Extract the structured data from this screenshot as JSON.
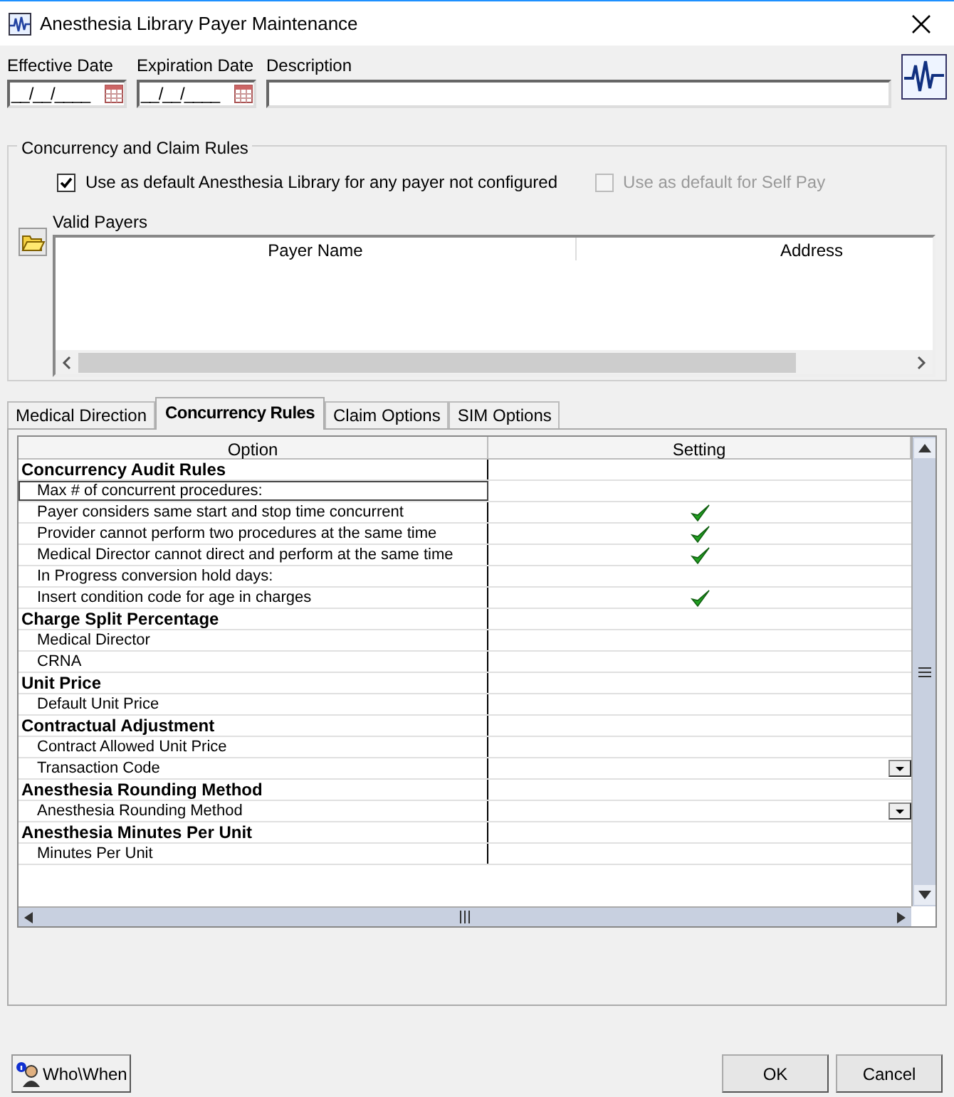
{
  "window": {
    "title": "Anesthesia Library Payer Maintenance"
  },
  "header": {
    "effective_date": {
      "label": "Effective Date",
      "value": "__/__/____"
    },
    "expiration_date": {
      "label": "Expiration Date",
      "value": "__/__/____"
    },
    "description": {
      "label": "Description"
    }
  },
  "rules_group": {
    "title": "Concurrency and Claim Rules",
    "checkboxes": [
      {
        "label": "Use as default Anesthesia Library for any payer not configured",
        "checked": true,
        "disabled": false
      },
      {
        "label": "Use as default for Self Pay",
        "checked": false,
        "disabled": true
      }
    ],
    "valid_payers": {
      "label": "Valid Payers",
      "columns": [
        "Payer Name",
        "Address"
      ]
    }
  },
  "tabs": [
    {
      "label": "Medical Direction",
      "selected": false
    },
    {
      "label": "Concurrency Rules",
      "selected": true
    },
    {
      "label": "Claim Options",
      "selected": false
    },
    {
      "label": "SIM Options",
      "selected": false
    }
  ],
  "grid": {
    "columns": [
      "Option",
      "Setting"
    ],
    "rows": [
      {
        "kind": "group",
        "label": "Concurrency Audit Rules"
      },
      {
        "kind": "item",
        "label": "Max # of concurrent procedures:",
        "checked": false,
        "selected": true
      },
      {
        "kind": "item",
        "label": "Payer considers same start and stop time concurrent",
        "checked": true,
        "selected": false
      },
      {
        "kind": "item",
        "label": "Provider cannot perform two procedures at the same time",
        "checked": true,
        "selected": false
      },
      {
        "kind": "item",
        "label": "Medical Director cannot direct and perform at the same time",
        "checked": true,
        "selected": false
      },
      {
        "kind": "item",
        "label": "In Progress conversion hold days:",
        "checked": false,
        "selected": false
      },
      {
        "kind": "item",
        "label": "Insert condition code for age in charges",
        "checked": true,
        "selected": false
      },
      {
        "kind": "group",
        "label": "Charge Split Percentage"
      },
      {
        "kind": "item",
        "label": "Medical Director",
        "checked": false,
        "selected": false
      },
      {
        "kind": "item",
        "label": "CRNA",
        "checked": false,
        "selected": false
      },
      {
        "kind": "group",
        "label": "Unit Price"
      },
      {
        "kind": "item",
        "label": "Default Unit Price",
        "checked": false,
        "selected": false
      },
      {
        "kind": "group",
        "label": "Contractual Adjustment"
      },
      {
        "kind": "item",
        "label": "Contract Allowed Unit Price",
        "checked": false,
        "selected": false
      },
      {
        "kind": "dropdown",
        "label": "Transaction Code",
        "selected": false
      },
      {
        "kind": "group",
        "label": "Anesthesia Rounding Method"
      },
      {
        "kind": "dropdown",
        "label": "Anesthesia Rounding Method",
        "selected": false
      },
      {
        "kind": "group",
        "label": "Anesthesia Minutes Per Unit"
      },
      {
        "kind": "item",
        "label": "Minutes Per Unit",
        "checked": false,
        "selected": false
      }
    ]
  },
  "buttons": {
    "who_when": "Who\\When",
    "ok": "OK",
    "cancel": "Cancel"
  }
}
